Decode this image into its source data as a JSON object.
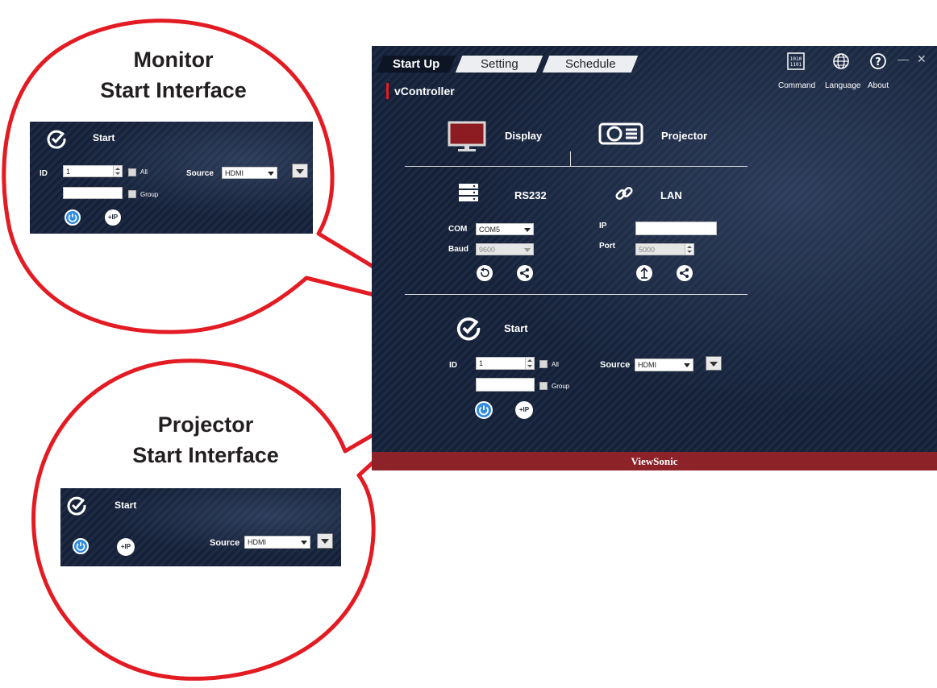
{
  "callouts": {
    "monitor": {
      "line1": "Monitor",
      "line2": "Start Interface"
    },
    "projector": {
      "line1": "Projector",
      "line2": "Start Interface"
    }
  },
  "tabs": [
    {
      "label": "Start Up",
      "active": true
    },
    {
      "label": "Setting",
      "active": false
    },
    {
      "label": "Schedule",
      "active": false
    }
  ],
  "app_title": "vController",
  "header_buttons": [
    {
      "label": "Command",
      "icon": "binary-icon"
    },
    {
      "label": "Language",
      "icon": "globe-icon"
    },
    {
      "label": "About",
      "icon": "help-icon"
    }
  ],
  "window_controls": {
    "minimize": "—",
    "close": "✕"
  },
  "device_types": {
    "display": "Display",
    "projector": "Projector"
  },
  "connections": {
    "rs232": {
      "title": "RS232",
      "com_label": "COM",
      "com_value": "COM5",
      "baud_label": "Baud",
      "baud_value": "9600"
    },
    "lan": {
      "title": "LAN",
      "ip_label": "IP",
      "ip_value": "",
      "port_label": "Port",
      "port_value": "5000"
    }
  },
  "start": {
    "title": "Start",
    "id_label": "ID",
    "id_value": "1",
    "all_label": "All",
    "group_label": "Group",
    "source_label": "Source",
    "source_value": "HDMI",
    "add_ip_label": "+IP"
  },
  "footer_brand": "ViewSonic",
  "colors": {
    "accent_red": "#e31b23",
    "footer": "#8d2329",
    "power_blue": "#2f8ae0",
    "background_navy": "#16233c"
  }
}
